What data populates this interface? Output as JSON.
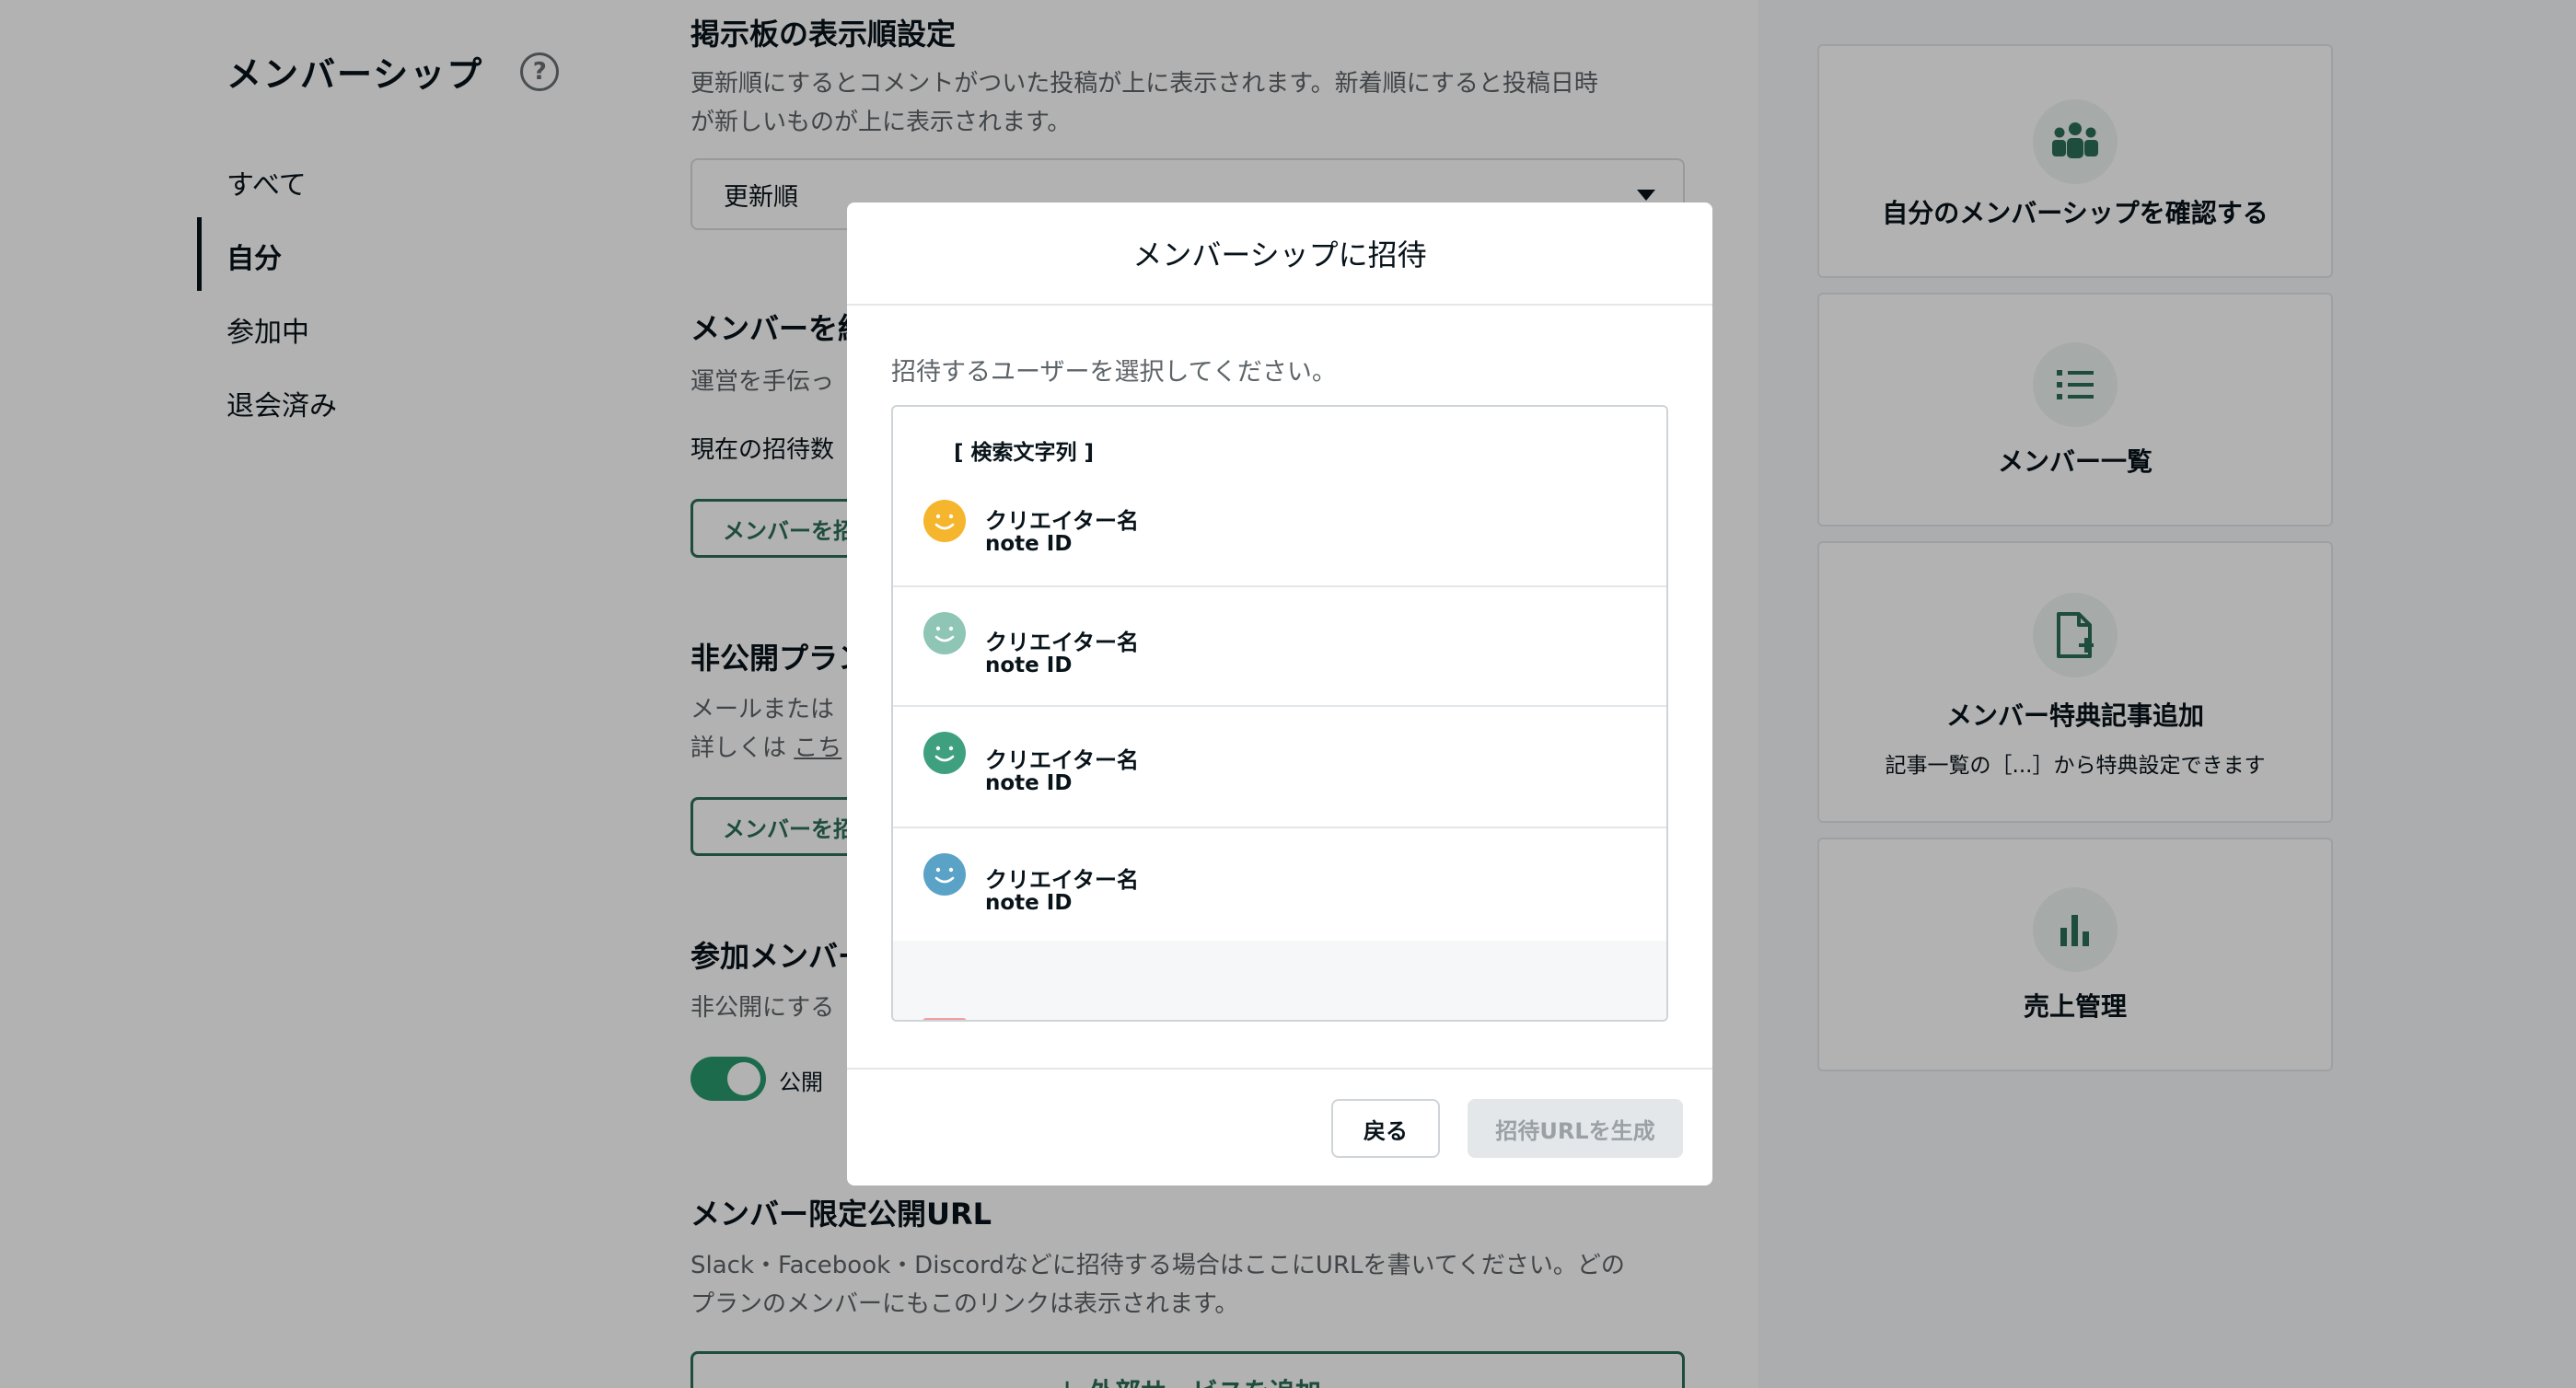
{
  "nav": {
    "title": "メンバーシップ",
    "items": [
      {
        "label": "すべて",
        "active": false
      },
      {
        "label": "自分",
        "active": true
      },
      {
        "label": "参加中",
        "active": false
      },
      {
        "label": "退会済み",
        "active": false
      }
    ]
  },
  "content": {
    "board_order": {
      "heading": "掲示板の表示順設定",
      "desc_1": "更新順にするとコメントがついた投稿が上に表示されます。新着順にすると投稿日時",
      "desc_2": "が新しいものが上に表示されます。",
      "selected": "更新順"
    },
    "invite": {
      "heading": "メンバーを紹",
      "desc": "運営を手伝っ",
      "count_text": "現在の招待数",
      "button": "メンバーを招"
    },
    "private_plan": {
      "heading": "非公開プラン",
      "desc_1": "メールまたは",
      "desc_2_prefix": "詳しくは ",
      "desc_2_link": "こち",
      "button": "メンバーを招"
    },
    "join_members": {
      "heading": "参加メンバー",
      "desc": "非公開にする",
      "toggle_label": "公開"
    },
    "member_url": {
      "heading": "メンバー限定公開URL",
      "desc_1": "Slack・Facebook・Discordなどに招待する場合はここにURLを書いてください。どの",
      "desc_2": "プランのメンバーにもこのリンクは表示されます。",
      "add_button": "＋ 外部サービスを追加"
    }
  },
  "sidebar_cards": [
    {
      "label": "自分のメンバーシップを確認する",
      "icon": "group-icon"
    },
    {
      "label": "メンバー一覧",
      "icon": "list-icon"
    },
    {
      "label": "メンバー特典記事追加",
      "sub": "記事一覧の［...］から特典設定できます",
      "icon": "add-file-icon"
    },
    {
      "label": "売上管理",
      "icon": "bar-chart-icon"
    }
  ],
  "modal": {
    "title": "メンバーシップに招待",
    "instruction": "招待するユーザーを選択してください。",
    "search_text": "[ 検索文字列 ]",
    "users": [
      {
        "name": "クリエイター名",
        "id": "note ID",
        "avatar_color": "#f5b52c",
        "selected": true
      },
      {
        "name": "クリエイター名",
        "id": "note ID",
        "avatar_color": "#8ec5b5",
        "selected": false
      },
      {
        "name": "クリエイター名",
        "id": "note ID",
        "avatar_color": "#3fa07f",
        "selected": false
      },
      {
        "name": "クリエイター名",
        "id": "note ID",
        "avatar_color": "#5aa3c7",
        "selected": false
      }
    ],
    "back_button": "戻る",
    "generate_button": "招待URLを生成"
  },
  "colors": {
    "accent": "#2c6e58",
    "toggle_on": "#2a9a6f",
    "overlay": "rgba(0,0,0,0.3)"
  }
}
